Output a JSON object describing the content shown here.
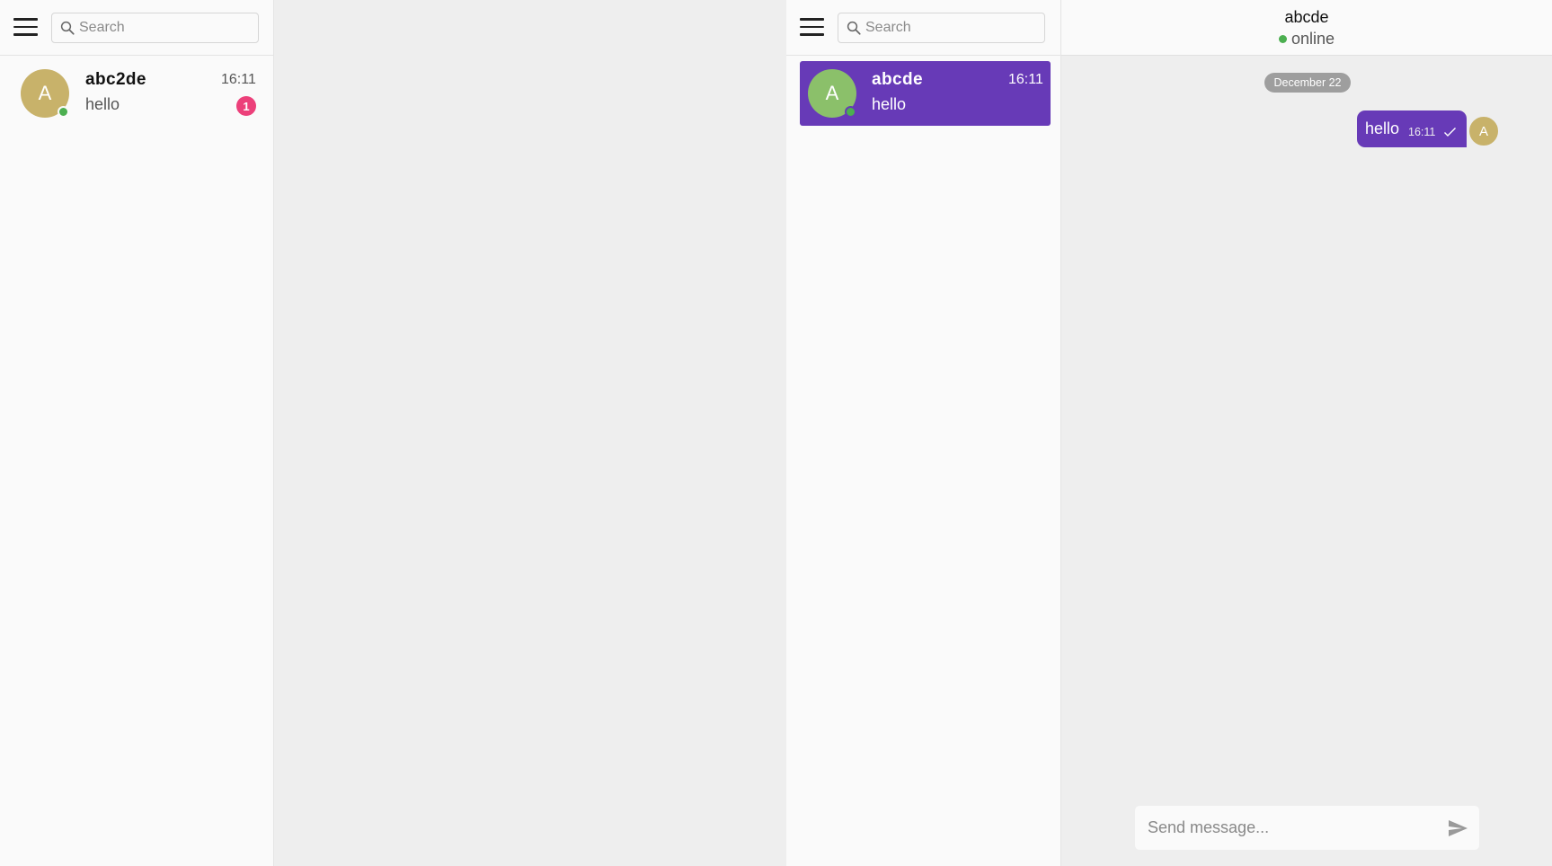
{
  "left_window": {
    "search": {
      "placeholder": "Search",
      "value": ""
    },
    "conversations": [
      {
        "avatar_letter": "A",
        "avatar_color": "#c8b26a",
        "online": true,
        "name": "abc2de",
        "time": "16:11",
        "preview": "hello",
        "unread": "1"
      }
    ]
  },
  "right_window": {
    "search": {
      "placeholder": "Search",
      "value": ""
    },
    "conversations": [
      {
        "avatar_letter": "A",
        "avatar_color": "#8bc06a",
        "online": true,
        "name": "abcde",
        "time": "16:11",
        "preview": "hello",
        "active": true
      }
    ],
    "chat": {
      "title": "abcde",
      "status": "online",
      "date_separator": "December 22",
      "messages": [
        {
          "text": "hello",
          "time": "16:11",
          "read_status": "sent-check",
          "sender_avatar_letter": "A",
          "sender_avatar_color": "#c8b26a"
        }
      ],
      "composer": {
        "placeholder": "Send message...",
        "value": ""
      }
    }
  },
  "colors": {
    "accent": "#673ab7",
    "online": "#4caf50",
    "badge": "#ec407a",
    "date_chip": "#9e9e9e"
  },
  "icons": {
    "menu": "hamburger-menu-icon",
    "search": "search-icon",
    "send": "send-icon",
    "check": "check-icon"
  }
}
